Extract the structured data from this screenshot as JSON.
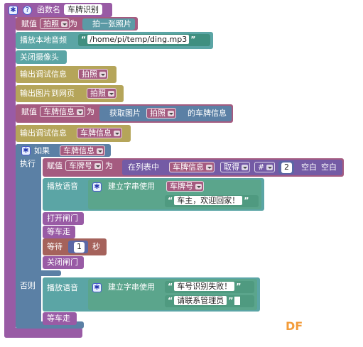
{
  "colors": {
    "procedure": "#995ba5",
    "variable_set": "#a55b80",
    "media": "#5b9aa5",
    "misc": "#5ba5a5",
    "debug": "#b5a55a",
    "control": "#5b80a5",
    "list": "#745ba5",
    "text": "#5ba58c",
    "wait": "#a5625b",
    "action": "#995ba5",
    "watermark": "#f39c3a"
  },
  "procedure": {
    "gear_icon": "gear-icon",
    "label": "函数名",
    "name": "车牌识别"
  },
  "blocks": {
    "assign1": {
      "label": "赋值",
      "var": "拍照",
      "to": "为",
      "value": "拍一张照片"
    },
    "play_local": {
      "label": "播放本地音频",
      "path": "/home/pi/temp/ding.mp3"
    },
    "close_camera": {
      "label": "关闭摄像头"
    },
    "debug1": {
      "label": "输出调试信息",
      "var": "拍照"
    },
    "output_web": {
      "label": "输出图片到网页",
      "var": "拍照"
    },
    "assign2": {
      "label": "赋值",
      "var": "车牌信息",
      "to": "为",
      "fetch": "获取图片",
      "fetch_var": "拍照",
      "suffix": "的车牌信息"
    },
    "debug2": {
      "label": "输出调试信息",
      "var": "车牌信息"
    },
    "if_block": {
      "if_label": "如果",
      "cond_var": "车牌信息",
      "then_label": "执行",
      "else_label": "否则"
    },
    "assign3": {
      "label": "赋值",
      "var": "车牌号",
      "to": "为",
      "in_list": "在列表中",
      "list_var": "车牌信息",
      "get": "取得",
      "hash": "#",
      "index": "2",
      "trim1": "空白",
      "trim2": "空白"
    },
    "play_speech1": {
      "label": "播放语音",
      "create": "建立字串使用",
      "item1": "车牌号",
      "item2": "车主，欢迎回家！"
    },
    "open_gate": {
      "label": "打开闸门"
    },
    "wait_car1": {
      "label": "等车走"
    },
    "wait": {
      "label": "等待",
      "value": "1",
      "unit": "秒"
    },
    "close_gate": {
      "label": "关闭闸门"
    },
    "play_speech2": {
      "label": "播放语音",
      "create": "建立字串使用",
      "item1": "车号识别失败！",
      "item2": "请联系管理员"
    },
    "wait_car2": {
      "label": "等车走"
    }
  },
  "watermark": "DF"
}
